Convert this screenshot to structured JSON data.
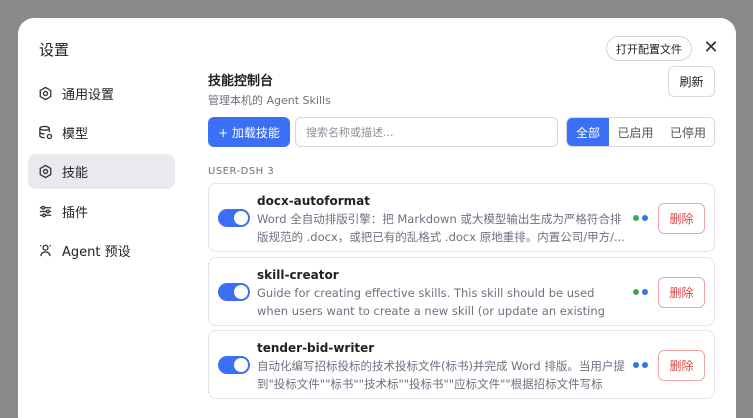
{
  "modal": {
    "title": "设置",
    "open_config_label": "打开配置文件",
    "close_icon": "close-icon"
  },
  "sidebar": {
    "items": [
      {
        "label": "通用设置",
        "icon": "gear-icon"
      },
      {
        "label": "模型",
        "icon": "database-icon"
      },
      {
        "label": "技能",
        "icon": "gear-icon",
        "active": true
      },
      {
        "label": "插件",
        "icon": "sliders-icon"
      },
      {
        "label": "Agent 预设",
        "icon": "agent-icon"
      }
    ]
  },
  "main": {
    "title": "技能控制台",
    "subtitle": "管理本机的 Agent Skills",
    "refresh_label": "刷新",
    "load_label": "+ 加载技能",
    "search_placeholder": "搜索名称或描述...",
    "filters": [
      "全部",
      "已启用",
      "已停用"
    ],
    "active_filter": "全部",
    "group_label": "USER-DSH  3"
  },
  "skills": [
    {
      "name": "docx-autoformat",
      "description": "Word 全自动排版引擎：把 Markdown 或大模型输出生成为严格符合排版规范的 .docx，或把已有的乱格式 .docx 原地重排。内置公司/甲方/...",
      "enabled": true,
      "delete_label": "删除"
    },
    {
      "name": "skill-creator",
      "description": "Guide for creating effective skills. This skill should be used when users want to create a new skill (or update an existing skill) that extends...",
      "enabled": true,
      "delete_label": "删除"
    },
    {
      "name": "tender-bid-writer",
      "description": "自动化编写招标投标的技术投标文件(标书)并完成 Word 排版。当用户提到\"投标文件\"\"标书\"\"技术标\"\"投标书\"\"应标文件\"\"根据招标文件写标书\"...",
      "enabled": true,
      "delete_label": "删除"
    }
  ],
  "colors": {
    "accent": "#3b6ff5",
    "danger": "#e04646",
    "status_dot_green": "#3ea65a",
    "status_dot_blue": "#3b6ff5",
    "backdrop": "#8a8a8a"
  }
}
